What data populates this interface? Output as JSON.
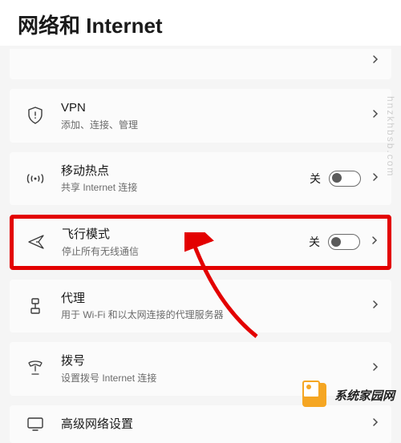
{
  "page": {
    "title": "网络和 Internet"
  },
  "items": {
    "partial_top": {
      "subtitle": ""
    },
    "vpn": {
      "title": "VPN",
      "subtitle": "添加、连接、管理"
    },
    "hotspot": {
      "title": "移动热点",
      "subtitle": "共享 Internet 连接",
      "toggle_state_label": "关"
    },
    "airplane": {
      "title": "飞行模式",
      "subtitle": "停止所有无线通信",
      "toggle_state_label": "关"
    },
    "proxy": {
      "title": "代理",
      "subtitle": "用于 Wi-Fi 和以太网连接的代理服务器"
    },
    "dialup": {
      "title": "拨号",
      "subtitle": "设置拨号 Internet 连接"
    },
    "advanced": {
      "title": "高级网络设置"
    }
  },
  "watermark": "hnzkhbsb.com",
  "footer": {
    "brand": "系统家园网"
  }
}
